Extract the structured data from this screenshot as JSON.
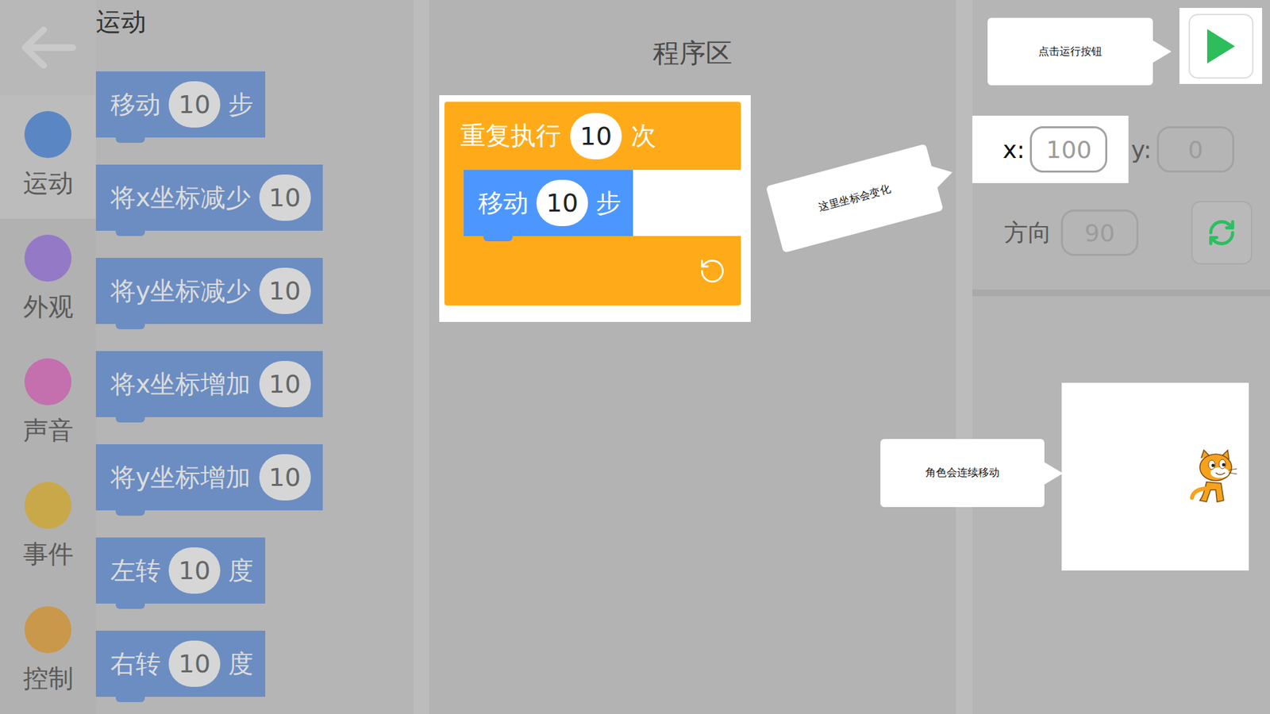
{
  "palette": {
    "title": "运动"
  },
  "categories": [
    {
      "label": "运动",
      "selected": true,
      "color": "#5b86c4"
    },
    {
      "label": "外观",
      "selected": false,
      "color": "#9479c6"
    },
    {
      "label": "声音",
      "selected": false,
      "color": "#c46fae"
    },
    {
      "label": "事件",
      "selected": false,
      "color": "#c9a84a"
    },
    {
      "label": "控制",
      "selected": false,
      "color": "#c9984a"
    }
  ],
  "blocks": [
    {
      "label": "移动",
      "value": "10",
      "unit": "步"
    },
    {
      "label": "将x坐标减少",
      "value": "10"
    },
    {
      "label": "将y坐标减少",
      "value": "10"
    },
    {
      "label": "将x坐标增加",
      "value": "10"
    },
    {
      "label": "将y坐标增加",
      "value": "10"
    },
    {
      "label": "左转",
      "value": "10",
      "unit": "度"
    },
    {
      "label": "右转",
      "value": "10",
      "unit": "度"
    }
  ],
  "program": {
    "title": "程序区",
    "repeat": {
      "label": "重复执行",
      "value": "10",
      "unit": "次",
      "body": [
        {
          "label": "移动",
          "value": "10",
          "unit": "步"
        }
      ]
    }
  },
  "coords": {
    "x_label": "x:",
    "x": "100",
    "y_label": "y:",
    "y": "0",
    "direction_label": "方向",
    "direction": "90"
  },
  "callouts": {
    "run": "点击运行按钮",
    "coords": "这里坐标会变化",
    "stage": "角色会连续移动"
  }
}
